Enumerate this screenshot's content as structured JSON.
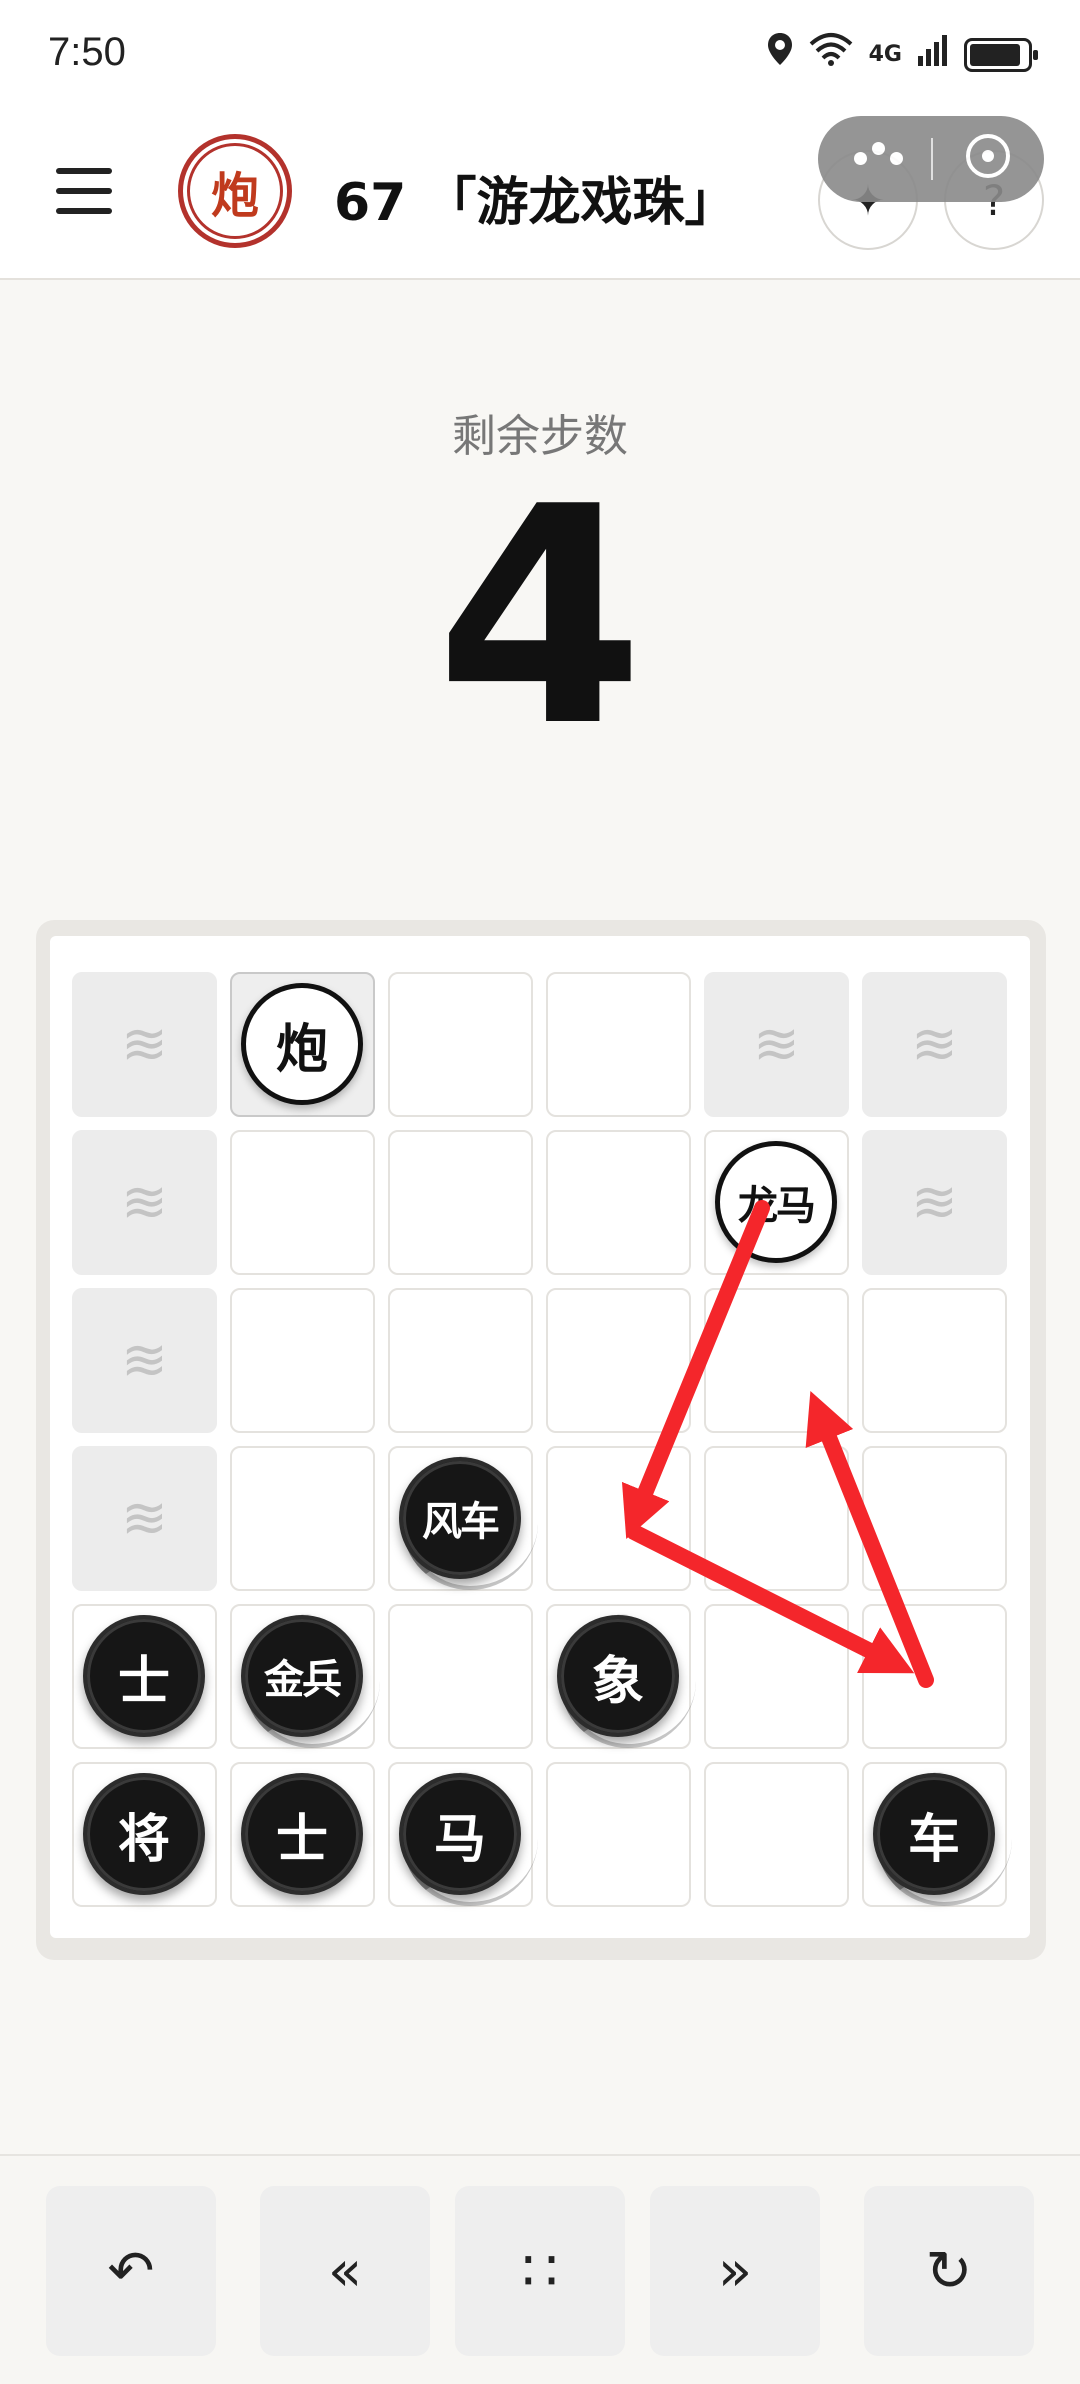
{
  "status": {
    "time": "7:50",
    "network": "4G",
    "icons": [
      "location-icon",
      "wifi-icon",
      "signal-icon",
      "battery-icon"
    ],
    "battery_level": 0.9
  },
  "header": {
    "title": "67 「游龙戏珠」",
    "logo_char": "炮",
    "icons": [
      "menu-icon",
      "capsule-more-icon",
      "capsule-close-icon",
      "sparkle-icon",
      "hint-icon"
    ],
    "sparkle_glyph": "✦",
    "hint_glyph": "?"
  },
  "steps": {
    "label": "剩余步数",
    "value": "4"
  },
  "board": {
    "rows": 6,
    "cols": 6,
    "water_glyph": "≋",
    "water_cells": [
      [
        0,
        0
      ],
      [
        0,
        4
      ],
      [
        0,
        5
      ],
      [
        1,
        0
      ],
      [
        1,
        5
      ],
      [
        2,
        0
      ],
      [
        3,
        0
      ]
    ],
    "highlight_cells": [
      [
        0,
        1
      ]
    ],
    "pieces": [
      {
        "row": 0,
        "col": 1,
        "side": "white",
        "label": "炮"
      },
      {
        "row": 1,
        "col": 4,
        "side": "white",
        "label": "龙马"
      },
      {
        "row": 3,
        "col": 2,
        "side": "black",
        "label": "风车",
        "trail": true
      },
      {
        "row": 4,
        "col": 0,
        "side": "black",
        "label": "士"
      },
      {
        "row": 4,
        "col": 1,
        "side": "black",
        "label": "金兵",
        "trail": true
      },
      {
        "row": 4,
        "col": 3,
        "side": "black",
        "label": "象",
        "trail": true
      },
      {
        "row": 5,
        "col": 0,
        "side": "black",
        "label": "将"
      },
      {
        "row": 5,
        "col": 1,
        "side": "black",
        "label": "士"
      },
      {
        "row": 5,
        "col": 2,
        "side": "black",
        "label": "马",
        "trail": true
      },
      {
        "row": 5,
        "col": 5,
        "side": "black",
        "label": "车",
        "trail": true
      }
    ],
    "arrow_color": "#f4262b"
  },
  "toolbar": {
    "undo": "↶",
    "prev": "«",
    "menu": "∷",
    "next": "»",
    "restart": "↻"
  }
}
